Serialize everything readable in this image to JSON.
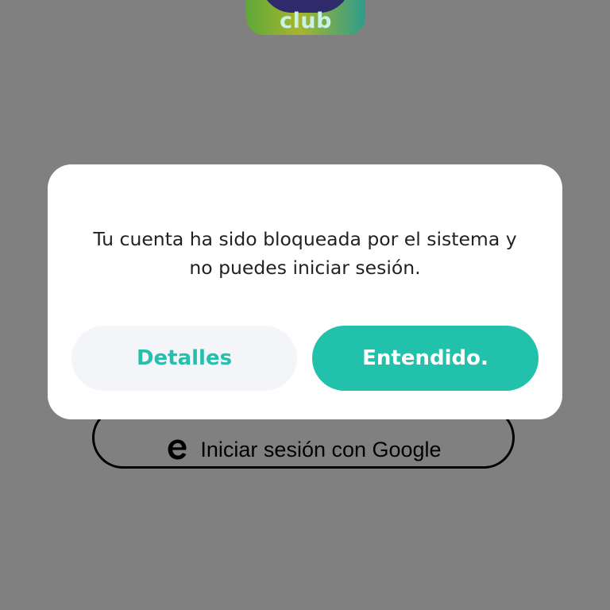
{
  "app": {
    "logo_text": "club",
    "logo_icon": "app-logo-icon"
  },
  "login": {
    "google_label": "Iniciar sesión con Google",
    "google_icon": "google-icon"
  },
  "dialog": {
    "message": "Tu cuenta ha sido bloqueada por el sistema y\nno puedes iniciar sesión.",
    "details_label": "Detalles",
    "ok_label": "Entendido."
  },
  "colors": {
    "overlay_background": "#808080",
    "accent": "#21c1ab",
    "secondary_button_bg": "#f4f5f8",
    "dialog_bg": "#ffffff"
  }
}
